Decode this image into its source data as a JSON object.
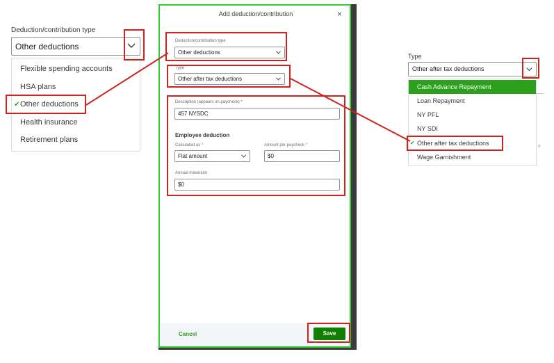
{
  "left_panel": {
    "label": "Deduction/contribution type",
    "selected_value": "Other deductions",
    "options": [
      {
        "label": "Flexible spending accounts",
        "checked": false
      },
      {
        "label": "HSA plans",
        "checked": false
      },
      {
        "label": "Other deductions",
        "checked": true
      },
      {
        "label": "Health insurance",
        "checked": false
      },
      {
        "label": "Retirement plans",
        "checked": false
      }
    ]
  },
  "modal": {
    "title": "Add deduction/contribution",
    "close_icon": "×",
    "deduction_type": {
      "label": "Deduction/contribution type",
      "value": "Other deductions"
    },
    "type": {
      "label": "Type",
      "value": "Other after tax deductions"
    },
    "description": {
      "label": "Description (appears on paycheck) *",
      "value": "457 NYSDC"
    },
    "employee_deduction": {
      "heading": "Employee deduction",
      "calculated_as": {
        "label": "Calculated as *",
        "value": "Flat amount"
      },
      "amount_per_paycheck": {
        "label": "Amount per paycheck *",
        "value": "$0"
      },
      "annual_maximum": {
        "label": "Annual maximum",
        "value": "$0"
      }
    },
    "footer": {
      "cancel_label": "Cancel",
      "save_label": "Save"
    }
  },
  "right_panel": {
    "label": "Type",
    "selected_value": "Other after tax deductions",
    "options": [
      {
        "label": "Cash Advance Repayment",
        "highlighted": true,
        "checked": false
      },
      {
        "label": "Loan Repayment",
        "highlighted": false,
        "checked": false
      },
      {
        "label": "NY PFL",
        "highlighted": false,
        "checked": false
      },
      {
        "label": "NY SDI",
        "highlighted": false,
        "checked": false
      },
      {
        "label": "Other after tax deductions",
        "highlighted": false,
        "checked": true
      },
      {
        "label": "Wage Garnishment",
        "highlighted": false,
        "checked": false
      }
    ],
    "background_fragment": "e"
  },
  "colors": {
    "accent_green": "#2ca01c",
    "save_green": "#108000",
    "annotation_red": "#d0211c",
    "modal_outline": "#33cc33"
  },
  "icons": {
    "check": "✔",
    "chevron": "chevron-down-icon"
  }
}
